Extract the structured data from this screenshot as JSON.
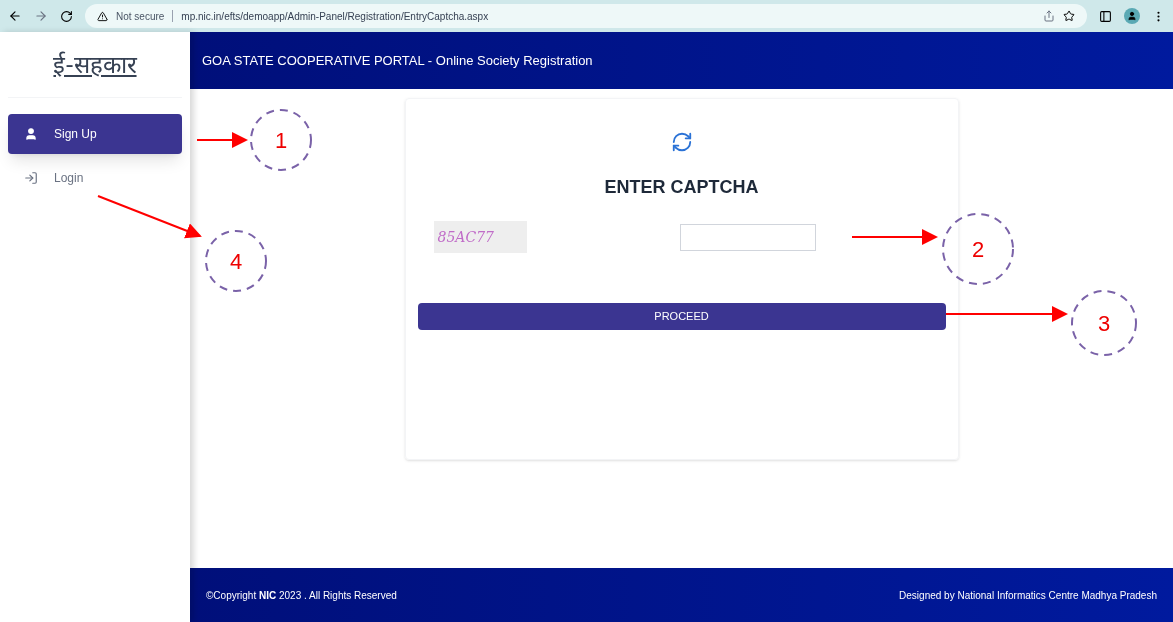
{
  "browser": {
    "security": "Not secure",
    "url": "mp.nic.in/efts/demoapp/Admin-Panel/Registration/EntryCaptcha.aspx"
  },
  "sidebar": {
    "logo": "ई-सहकार",
    "items": [
      {
        "label": "Sign Up",
        "kind": "user",
        "selected": true
      },
      {
        "label": "Login",
        "kind": "login",
        "selected": false
      }
    ]
  },
  "header": {
    "title": "GOA STATE COOPERATIVE PORTAL - Online Society Registration"
  },
  "captcha_card": {
    "title": "ENTER CAPTCHA",
    "captcha_text": "85AC77",
    "button": "PROCEED"
  },
  "footer": {
    "copyright": "©Copyright **NIC** 2023 . All Rights Reserved",
    "credit": "Designed by National Informatics Centre Madhya Pradesh"
  },
  "annotations": [
    {
      "number": "1"
    },
    {
      "number": "2"
    },
    {
      "number": "3"
    },
    {
      "number": "4"
    }
  ]
}
